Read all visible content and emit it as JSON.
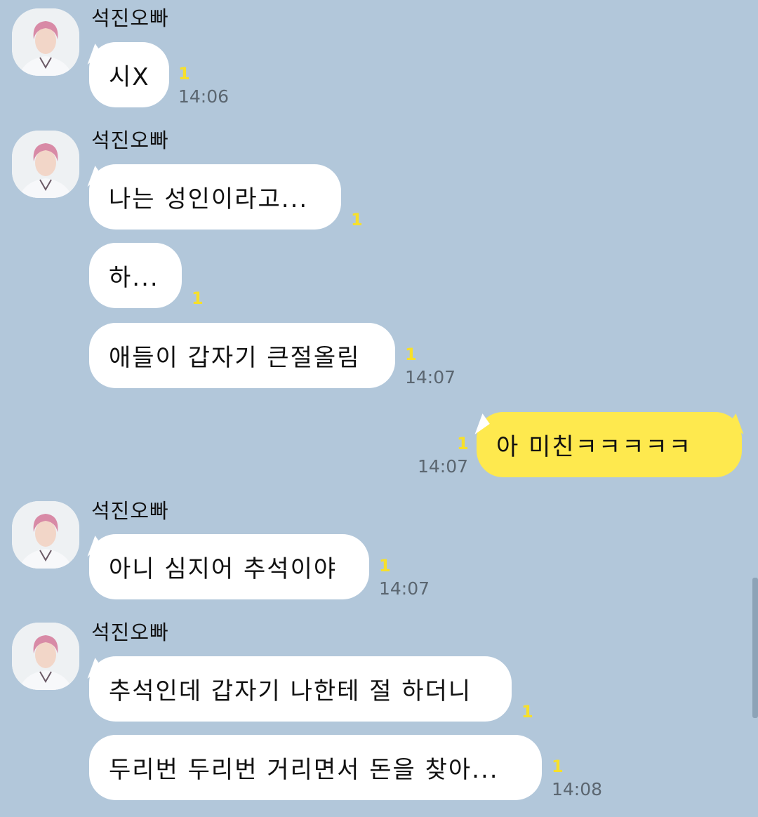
{
  "contact": {
    "name": "석진오빠"
  },
  "groups": [
    {
      "sender": "석진오빠",
      "messages": [
        {
          "text": "시X",
          "unread": "1",
          "time": "14:06"
        }
      ]
    },
    {
      "sender": "석진오빠",
      "messages": [
        {
          "text": "나는 성인이라고...",
          "unread": "1",
          "time": ""
        },
        {
          "text": "하...",
          "unread": "1",
          "time": ""
        },
        {
          "text": "애들이 갑자기 큰절올림",
          "unread": "1",
          "time": "14:07"
        }
      ]
    },
    {
      "sender": "me",
      "messages": [
        {
          "text": "아 미친ㅋㅋㅋㅋㅋ",
          "unread": "1",
          "time": "14:07"
        }
      ]
    },
    {
      "sender": "석진오빠",
      "messages": [
        {
          "text": "아니 심지어 추석이야",
          "unread": "1",
          "time": "14:07"
        }
      ]
    },
    {
      "sender": "석진오빠",
      "messages": [
        {
          "text": "추석인데 갑자기 나한테 절 하더니",
          "unread": "1",
          "time": ""
        },
        {
          "text": "두리번 두리번 거리면서 돈을 찾아...",
          "unread": "1",
          "time": "14:08"
        }
      ]
    }
  ],
  "colors": {
    "background": "#b2c7da",
    "bubble_received": "#ffffff",
    "bubble_sent": "#fee94e",
    "unread_badge": "#f7e02a",
    "timestamp": "#5b6670"
  },
  "icons": {
    "avatar": "profile-photo-avatar"
  }
}
